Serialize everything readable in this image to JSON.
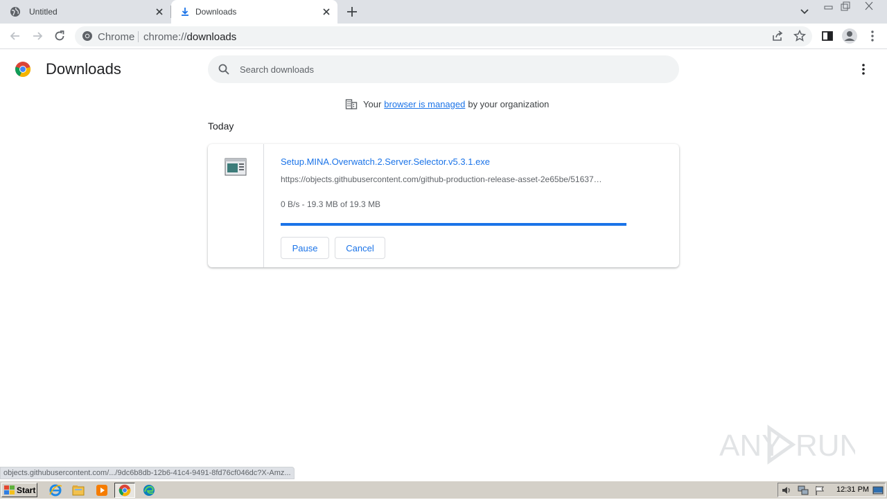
{
  "tabs": [
    {
      "label": "Untitled",
      "icon": "globe-icon",
      "active": false
    },
    {
      "label": "Downloads",
      "icon": "download-icon",
      "active": true
    }
  ],
  "omnibox": {
    "site_label": "Chrome",
    "url_scheme": "chrome://",
    "url_path": "downloads"
  },
  "page": {
    "title": "Downloads",
    "search_placeholder": "Search downloads",
    "managed_prefix": "Your",
    "managed_link": "browser is managed",
    "managed_suffix": "by your organization",
    "section_today": "Today"
  },
  "download": {
    "file_name": "Setup.MINA.Overwatch.2.Server.Selector.v5.3.1.exe",
    "url": "https://objects.githubusercontent.com/github-production-release-asset-2e65be/51637…",
    "status": "0 B/s - 19.3 MB of 19.3 MB",
    "progress_percent": 100,
    "pause_label": "Pause",
    "cancel_label": "Cancel"
  },
  "status_bar": {
    "text": "objects.githubusercontent.com/.../9dc6b8db-12b6-41c4-9491-8fd76cf046dc?X-Amz..."
  },
  "watermark": {
    "text": "ANY RUN"
  },
  "taskbar": {
    "start_label": "Start",
    "clock": "12:31 PM"
  },
  "colors": {
    "accent": "#1a73e8",
    "tabstrip": "#dee1e6",
    "taskbar": "#d4d0c8"
  }
}
